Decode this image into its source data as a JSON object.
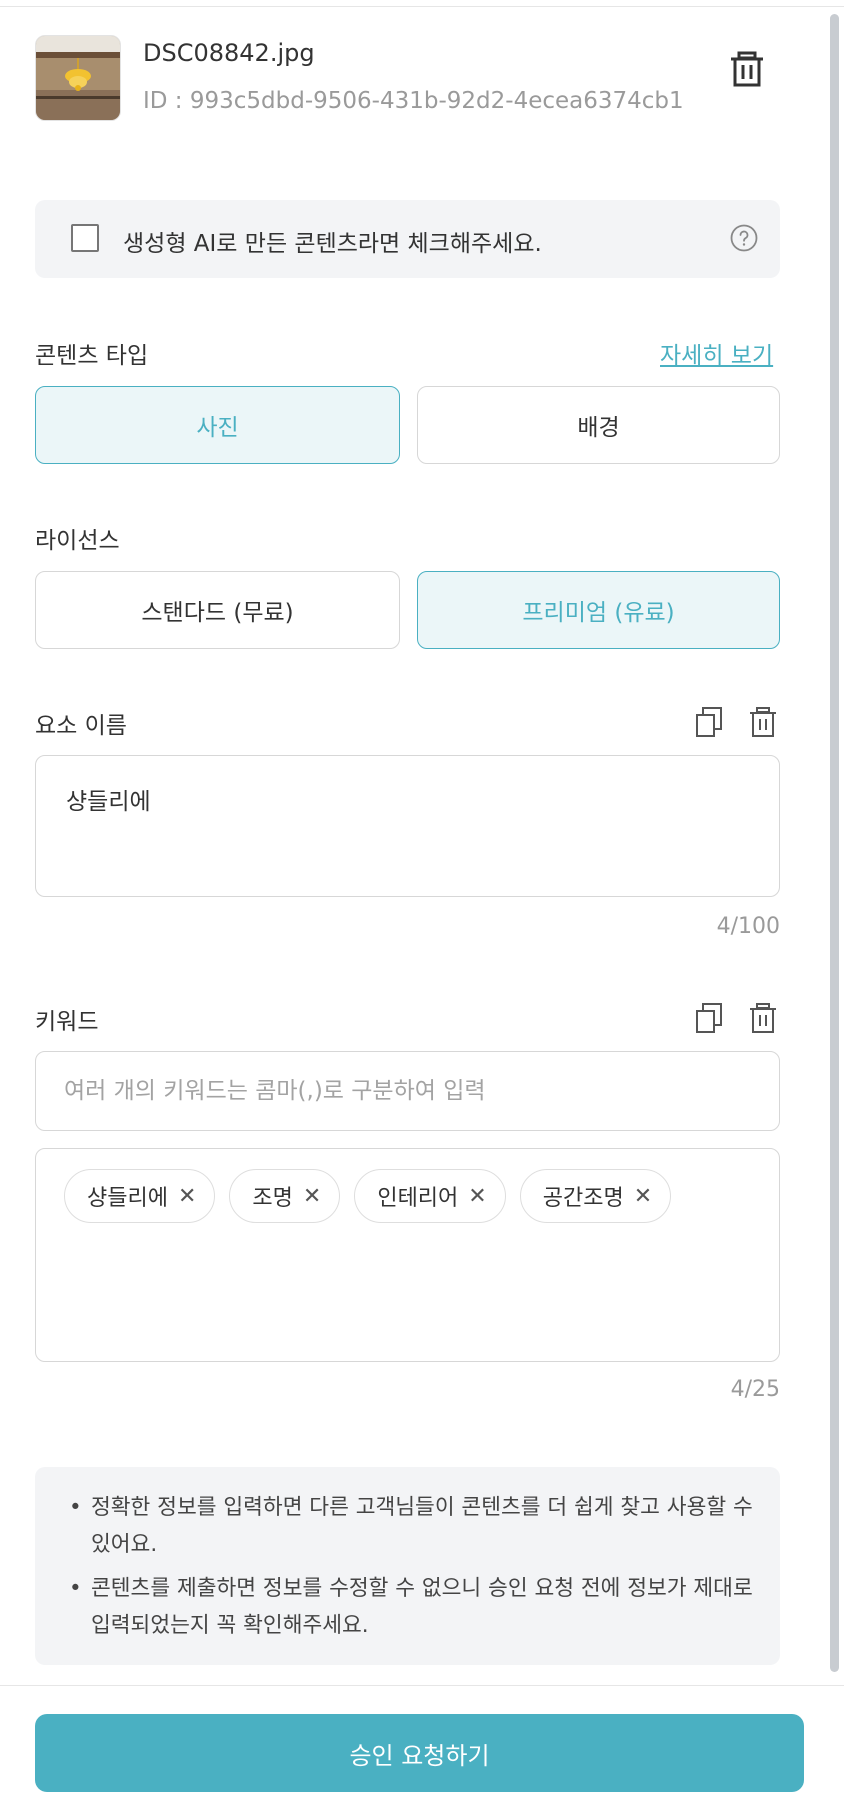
{
  "file": {
    "name": "DSC08842.jpg",
    "id_text": "ID : 993c5dbd-9506-431b-92d2-4ecea6374cb1"
  },
  "ai_notice": {
    "label": "생성형 AI로 만든 콘텐츠라면 체크해주세요.",
    "checked": false
  },
  "content_type": {
    "label": "콘텐츠 타입",
    "detail_link": "자세히 보기",
    "options": [
      "사진",
      "배경"
    ],
    "selected": "사진"
  },
  "license": {
    "label": "라이선스",
    "options": [
      "스탠다드 (무료)",
      "프리미엄 (유료)"
    ],
    "selected": "프리미엄 (유료)"
  },
  "element_name": {
    "label": "요소 이름",
    "value": "샹들리에",
    "counter": "4/100"
  },
  "keywords": {
    "label": "키워드",
    "placeholder": "여러 개의 키워드는 콤마(,)로 구분하여 입력",
    "tags": [
      "샹들리에",
      "조명",
      "인테리어",
      "공간조명"
    ],
    "remove_glyph": "✕",
    "counter": "4/25"
  },
  "notices": [
    "정확한 정보를 입력하면 다른 고객님들이 콘텐츠를 더 쉽게 찾고 사용할 수 있어요.",
    "콘텐츠를 제출하면 정보를 수정할 수 없으니 승인 요청 전에 정보가 제대로 입력되었는지 꼭 확인해주세요."
  ],
  "submit_label": "승인 요청하기",
  "colors": {
    "accent": "#4ab0c2",
    "accent_bg": "#ebf6f8",
    "panel_bg": "#f3f4f6",
    "border": "#d7d7d7"
  }
}
